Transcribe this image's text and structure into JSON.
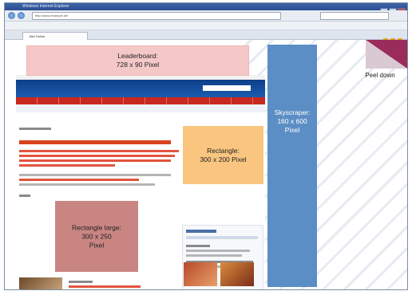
{
  "browser": {
    "title": "Windows Internet Explorer",
    "tab_label": "Bild Online",
    "url": "http://www.example.de/"
  },
  "ads": {
    "leaderboard": {
      "name": "Leaderboard:",
      "size": "728 x 90 Pixel"
    },
    "skyscraper": {
      "name": "Skyscraper:",
      "size": "160 x 600",
      "unit": "Pixel"
    },
    "rectangle": {
      "name": "Rectangle:",
      "size": "300 x 200 Pixel"
    },
    "rectangle_large": {
      "name": "Rectangle large:",
      "size": "300 x 250",
      "unit": "Pixel"
    },
    "peel_down": {
      "name": "Peel down"
    }
  },
  "colors": {
    "leaderboard": "#f5c8c8",
    "skyscraper": "#5b8ec5",
    "rectangle": "#f9c57f",
    "rectangle_large": "#c98582",
    "peel": "#9a2c5c",
    "site_header": "#1b5bb0",
    "site_nav": "#c8281e"
  }
}
